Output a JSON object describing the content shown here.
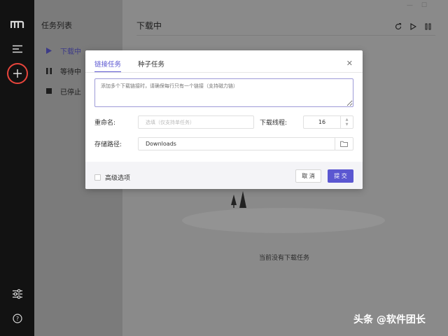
{
  "sidebar": {
    "icons": [
      "logo-icon",
      "menu-icon",
      "add-task-icon",
      "settings-icon",
      "help-icon"
    ]
  },
  "tasklist": {
    "title": "任务列表",
    "items": [
      {
        "label": "下载中",
        "icon": "play-icon",
        "active": true
      },
      {
        "label": "等待中",
        "icon": "pause-icon",
        "active": false
      },
      {
        "label": "已停止",
        "icon": "stop-icon",
        "active": false
      }
    ]
  },
  "main": {
    "title": "下载中",
    "empty_text": "当前没有下载任务",
    "tools": [
      "refresh-icon",
      "play-icon",
      "pause-icon"
    ]
  },
  "dialog": {
    "tabs": [
      "链接任务",
      "种子任务"
    ],
    "active_tab": 0,
    "url_placeholder": "添加多个下载链接时，请确保每行只有一个链接（支持磁力链）",
    "rename_label": "重命名:",
    "rename_placeholder": "选填（仅支持单任务）",
    "threads_label": "下载线程:",
    "threads_value": "16",
    "path_label": "存储路径:",
    "path_value": "Downloads",
    "advanced_label": "高级选项",
    "cancel_label": "取 消",
    "submit_label": "提 交"
  },
  "watermark": "头条 @软件团长",
  "colors": {
    "accent": "#5b57d1",
    "add_ring": "#e8453c",
    "sidebar": "#121212"
  }
}
